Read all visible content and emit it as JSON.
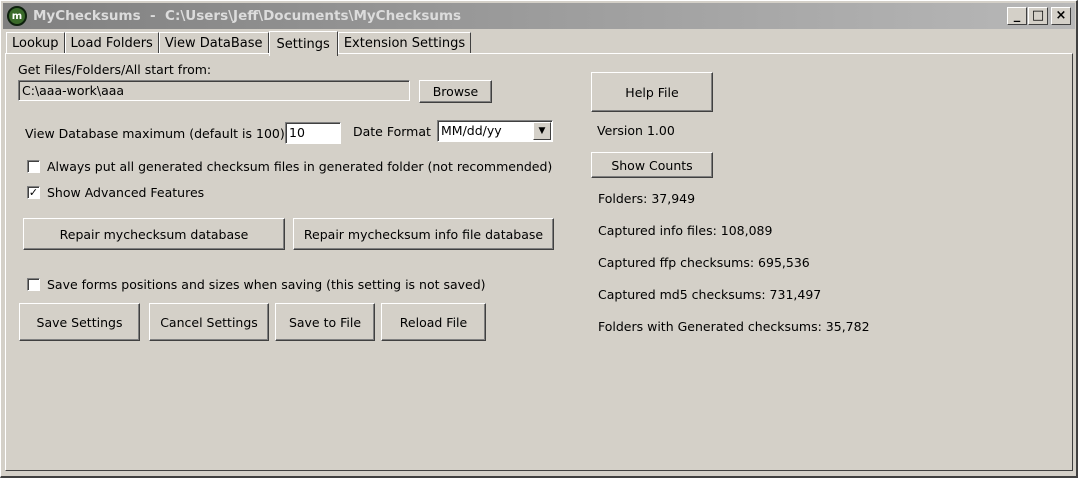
{
  "window": {
    "icon_text": "m",
    "title": "MyChecksums  -  C:\\Users\\Jeff\\Documents\\MyChecksums",
    "minimize": "_",
    "maximize": "□",
    "close": "×"
  },
  "tabs": [
    {
      "label": "Lookup",
      "active": false
    },
    {
      "label": "Load Folders",
      "active": false
    },
    {
      "label": "View DataBase",
      "active": false
    },
    {
      "label": "Settings",
      "active": true
    },
    {
      "label": "Extension Settings",
      "active": false
    }
  ],
  "settings": {
    "start_from_label": "Get Files/Folders/All start from:",
    "start_from_value": "C:\\aaa-work\\aaa",
    "browse_label": "Browse",
    "view_db_max_label": "View Database maximum (default is 100)",
    "view_db_max_value": "10",
    "date_format_label": "Date Format",
    "date_format_value": "MM/dd/yy",
    "checkbox_generated_folder": {
      "label": "Always put all generated checksum files in generated folder (not recommended)",
      "checked": false
    },
    "checkbox_advanced": {
      "label": "Show Advanced Features",
      "checked": true
    },
    "repair_db_label": "Repair mychecksum database",
    "repair_info_db_label": "Repair mychecksum info file database",
    "checkbox_save_forms": {
      "label": "Save forms positions and sizes when saving (this setting is not saved)",
      "checked": false
    },
    "save_settings_label": "Save Settings",
    "cancel_settings_label": "Cancel Settings",
    "save_to_file_label": "Save to File",
    "reload_file_label": "Reload File"
  },
  "info": {
    "help_file_label": "Help File",
    "version": "Version 1.00",
    "show_counts_label": "Show Counts",
    "folders": "Folders: 37,949",
    "captured_info_files": "Captured info files: 108,089",
    "captured_ffp": "Captured ffp checksums: 695,536",
    "captured_md5": "Captured md5 checksums: 731,497",
    "folders_generated": "Folders with Generated checksums: 35,782"
  },
  "check_mark": "✓"
}
